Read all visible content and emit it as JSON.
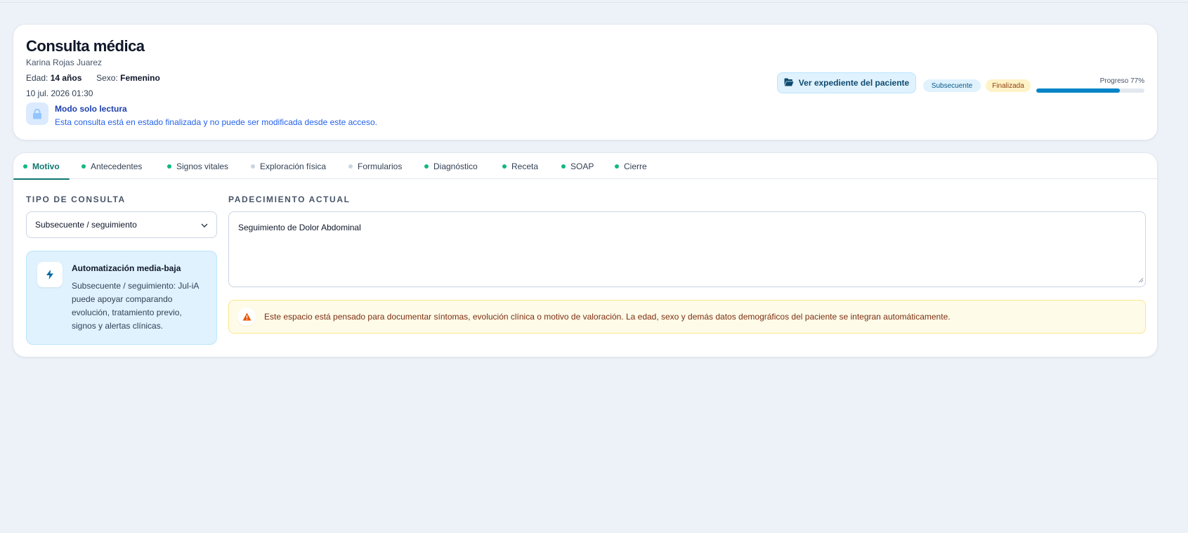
{
  "header": {
    "title": "Consulta médica",
    "patient_name": "Karina Rojas Juarez",
    "age_label": "Edad:",
    "age_value": "14 años",
    "sex_label": "Sexo:",
    "sex_value": "Femenino",
    "datetime": "10 jul. 2026 01:30",
    "readonly_title": "Modo solo lectura",
    "readonly_desc": "Esta consulta está en estado finalizada y no puede ser modificada desde este acceso.",
    "record_button": "Ver expediente del paciente",
    "badge_type": "Subsecuente",
    "badge_status": "Finalizada",
    "progress_label": "Progreso 77%",
    "progress_value": 77
  },
  "tabs": [
    {
      "label": "Motivo",
      "status": "complete",
      "active": true
    },
    {
      "label": "Antecedentes",
      "status": "complete"
    },
    {
      "label": "Signos vitales",
      "status": "complete"
    },
    {
      "label": "Exploración física",
      "status": "pending"
    },
    {
      "label": "Formularios",
      "status": "pending"
    },
    {
      "label": "Diagnóstico",
      "status": "complete"
    },
    {
      "label": "Receta",
      "status": "complete"
    },
    {
      "label": "SOAP",
      "status": "complete"
    },
    {
      "label": "Cierre",
      "status": "complete"
    }
  ],
  "motivo": {
    "consult_type_label": "TIPO DE CONSULTA",
    "consult_type_value": "Subsecuente / seguimiento",
    "automation_title": "Automatización media-baja",
    "automation_text": "Subsecuente / seguimiento: Jul-iA puede apoyar comparando evolución, tratamiento previo, signos y alertas clínicas.",
    "current_illness_label": "PADECIMIENTO ACTUAL",
    "current_illness_value": "Seguimiento de Dolor Abdominal",
    "notice": "Este espacio está pensado para documentar síntomas, evolución clínica o motivo de valoración. La edad, sexo y demás datos demográficos del paciente se integran automáticamente."
  },
  "colors": {
    "accent": "#0f766e",
    "complete_dot": "#10b981",
    "pending_dot": "#cbd5e1",
    "progress": "#0284c7"
  },
  "icons": {
    "lock": "lock-icon",
    "folder": "folder-open-icon",
    "bolt": "bolt-icon",
    "warning": "warning-icon",
    "chevron": "chevron-down-icon"
  }
}
